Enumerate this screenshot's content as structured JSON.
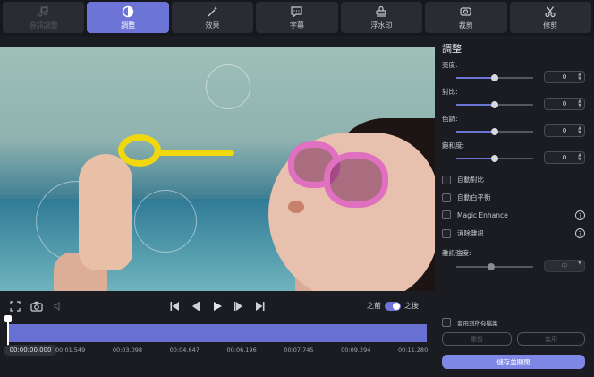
{
  "tabs": [
    {
      "label": "音訊調整",
      "icon": "music-note-icon",
      "state": "disabled"
    },
    {
      "label": "調整",
      "icon": "adjust-icon",
      "state": "active"
    },
    {
      "label": "效果",
      "icon": "magic-wand-icon",
      "state": "normal"
    },
    {
      "label": "字幕",
      "icon": "subtitle-bubble-icon",
      "state": "normal"
    },
    {
      "label": "浮水印",
      "icon": "stamp-icon",
      "state": "normal"
    },
    {
      "label": "裁剪",
      "icon": "crop-icon",
      "state": "normal"
    },
    {
      "label": "修剪",
      "icon": "scissors-icon",
      "state": "normal"
    }
  ],
  "controls": {
    "before_label": "之前",
    "after_label": "之後",
    "before_after_on": true
  },
  "timeline": {
    "current": "00:00:00.000",
    "ticks": [
      "00:01.549",
      "00:03.098",
      "00:04.647",
      "00:06.196",
      "00:07.745",
      "00:09.294",
      "00:11.280"
    ]
  },
  "panel": {
    "title": "調整",
    "sliders": [
      {
        "label": "亮度:",
        "value": "0",
        "level": 0.5
      },
      {
        "label": "對比:",
        "value": "0",
        "level": 0.5
      },
      {
        "label": "色調:",
        "value": "0",
        "level": 0.5
      },
      {
        "label": "飽和度:",
        "value": "0",
        "level": 0.5
      }
    ],
    "options": [
      {
        "label": "自動對比",
        "help": false
      },
      {
        "label": "自動白平衡",
        "help": false
      },
      {
        "label": "Magic Enhance",
        "help": true
      },
      {
        "label": "消除雜訊",
        "help": true
      }
    ],
    "denoise": {
      "label": "雜訊強度:",
      "value": "中",
      "level": 0.45
    },
    "apply_all": "套用到所有檔案",
    "reset_label": "重設",
    "apply_label": "套用",
    "save_close_label": "儲存並關閉"
  },
  "colors": {
    "accent": "#6c74d6",
    "primary_button": "#7f87e6"
  }
}
